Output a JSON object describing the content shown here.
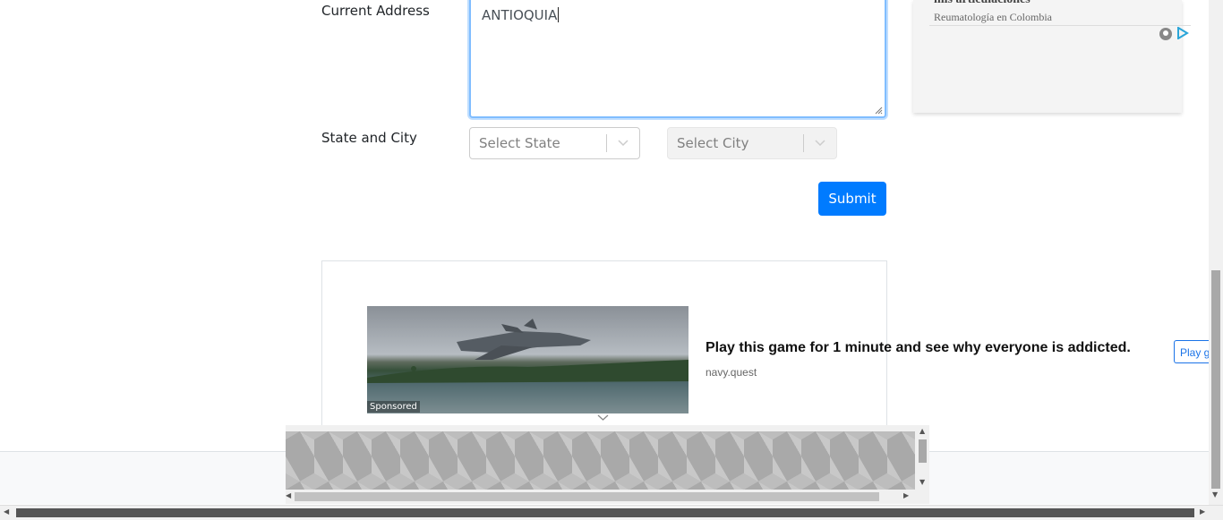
{
  "form": {
    "address_label": "Current Address",
    "address_value": "ANTIOQUIA",
    "state_city_label": "State and City",
    "state_placeholder": "Select State",
    "city_placeholder": "Select City",
    "submit_label": "Submit"
  },
  "side_ad": {
    "headline": "mis articulaciones",
    "source": "Reumatología en Colombia"
  },
  "bottom_ad": {
    "sponsored": "Sponsored",
    "title": "Play this game for 1 minute and see why everyone is addicted.",
    "domain": "navy.quest",
    "cta": "Play game"
  },
  "colors": {
    "primary": "#007bff",
    "focus_border": "#80bdff"
  }
}
